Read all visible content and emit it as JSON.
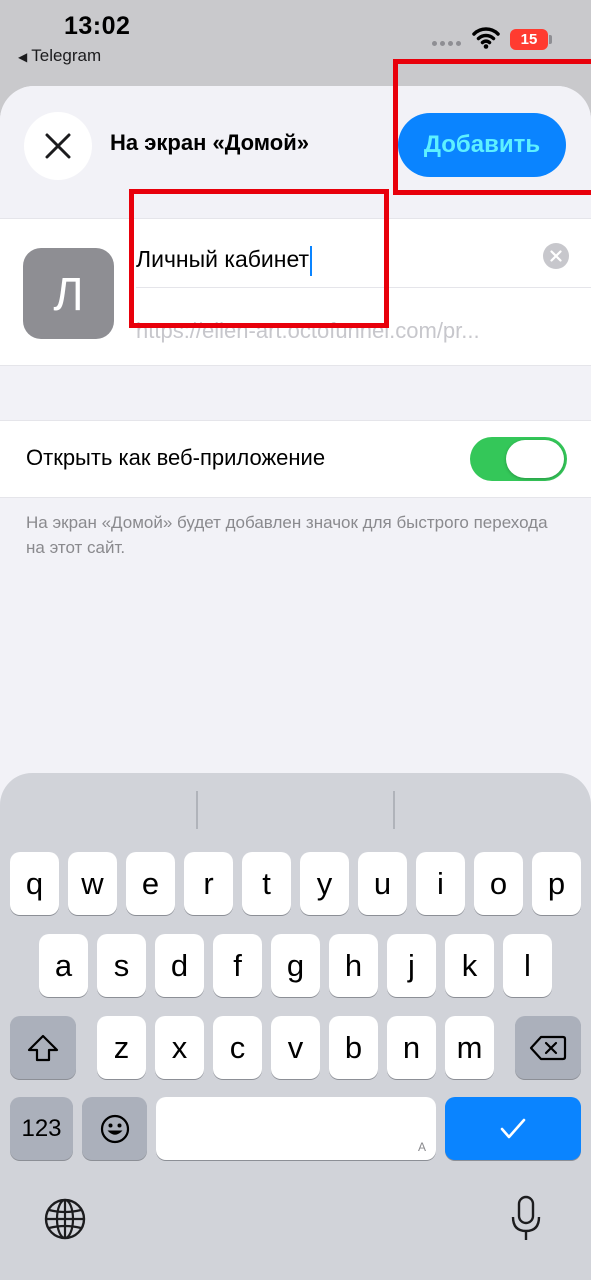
{
  "status_bar": {
    "time": "13:02",
    "back_app": "Telegram",
    "battery": "15"
  },
  "sheet": {
    "title": "На экран «Домой»",
    "add_label": "Добавить",
    "icon_letter": "Л",
    "name_value": "Личный кабинет",
    "url_value": "https://ellen-art.octofunnel.com/pr...",
    "toggle_label": "Открыть как веб-приложение",
    "toggle_on": true,
    "hint": "На экран «Домой» будет добавлен значок для быстрого перехода на этот сайт."
  },
  "colors": {
    "accent": "#0a84ff",
    "toggle_on": "#34c759",
    "annotation_red": "#e8000b"
  },
  "keyboard": {
    "row1": [
      "q",
      "w",
      "e",
      "r",
      "t",
      "y",
      "u",
      "i",
      "o",
      "p"
    ],
    "row2": [
      "a",
      "s",
      "d",
      "f",
      "g",
      "h",
      "j",
      "k",
      "l"
    ],
    "row3": [
      "z",
      "x",
      "c",
      "v",
      "b",
      "n",
      "m"
    ],
    "numbers_label": "123",
    "space_hint": "A"
  }
}
